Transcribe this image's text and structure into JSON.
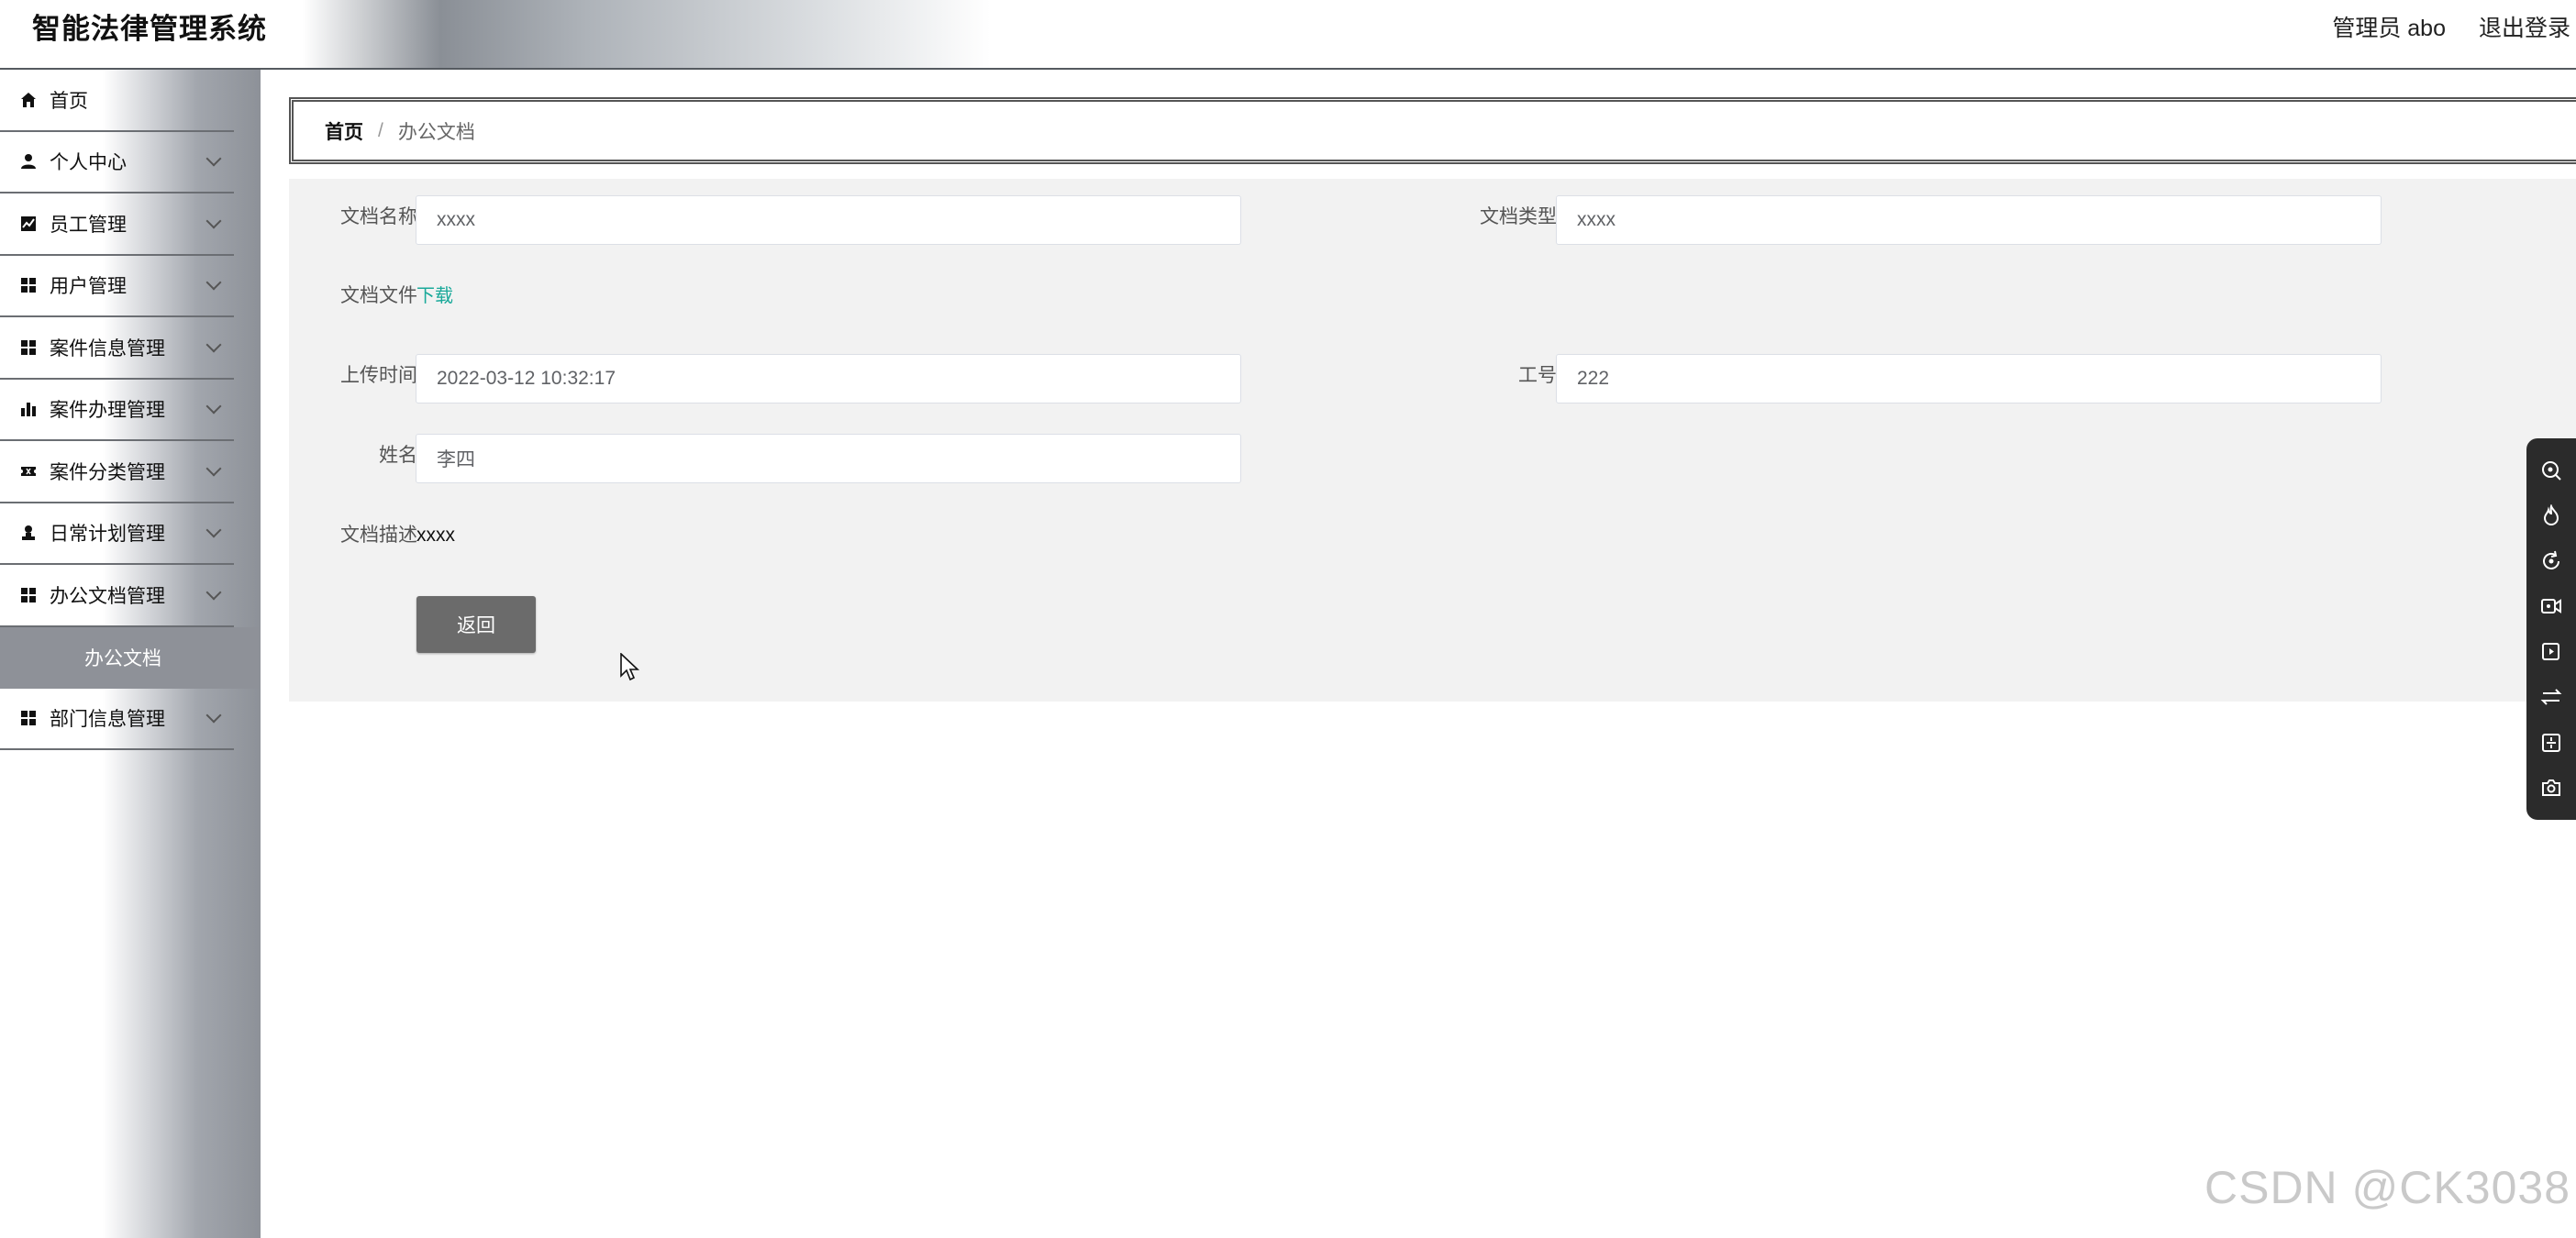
{
  "header": {
    "app_title": "智能法律管理系统",
    "admin_label": "管理员 abo",
    "logout_label": "退出登录"
  },
  "sidebar": {
    "items": [
      {
        "label": "首页",
        "icon": "home-icon"
      },
      {
        "label": "个人中心",
        "icon": "user-icon"
      },
      {
        "label": "员工管理",
        "icon": "chart-line-icon"
      },
      {
        "label": "用户管理",
        "icon": "grid-icon"
      },
      {
        "label": "案件信息管理",
        "icon": "grid-icon"
      },
      {
        "label": "案件办理管理",
        "icon": "bar-chart-icon"
      },
      {
        "label": "案件分类管理",
        "icon": "ticket-icon"
      },
      {
        "label": "日常计划管理",
        "icon": "person-stamp-icon"
      },
      {
        "label": "办公文档管理",
        "icon": "grid-icon"
      },
      {
        "label": "部门信息管理",
        "icon": "grid-icon"
      }
    ],
    "active_submenu": "办公文档"
  },
  "breadcrumb": {
    "home": "首页",
    "separator": "/",
    "current": "办公文档"
  },
  "form": {
    "doc_name_label": "文档名称",
    "doc_name_value": "xxxx",
    "doc_type_label": "文档类型",
    "doc_type_value": "xxxx",
    "doc_file_label": "文档文件",
    "download_label": "下载",
    "upload_time_label": "上传时间",
    "upload_time_value": "2022-03-12 10:32:17",
    "job_no_label": "工号",
    "job_no_value": "222",
    "name_label": "姓名",
    "name_value": "李四",
    "desc_label": "文档描述",
    "desc_value": "xxxx",
    "back_button": "返回"
  },
  "toolbar_icons": [
    "search-target-icon",
    "fire-icon",
    "refresh-icon",
    "video-record-icon",
    "play-frame-icon",
    "swap-icon",
    "crop-icon",
    "camera-icon"
  ],
  "watermark": "CSDN @CK3038",
  "colors": {
    "link": "#1aa99a",
    "button": "#6b6b6b",
    "submenu_active": "#8e9198"
  }
}
